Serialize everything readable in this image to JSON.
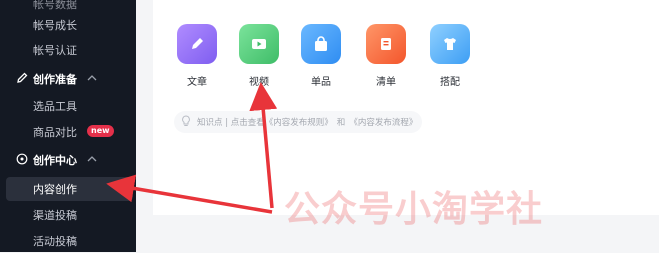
{
  "sidebar": {
    "top_cut_label": "帐号数据",
    "items_top": [
      {
        "label": "帐号成长"
      },
      {
        "label": "帐号认证"
      }
    ],
    "group_prep": {
      "label": "创作准备",
      "icon": "pencil-icon"
    },
    "prep_items": [
      {
        "label": "选品工具"
      },
      {
        "label": "商品对比",
        "badge": "new"
      }
    ],
    "group_center": {
      "label": "创作中心",
      "icon": "compass-icon"
    },
    "center_items": [
      {
        "label": "内容创作",
        "active": true
      },
      {
        "label": "渠道投稿"
      },
      {
        "label": "活动投稿"
      }
    ]
  },
  "tools": [
    {
      "label": "文章",
      "icon": "pen-icon",
      "color": "#8f6bf5"
    },
    {
      "label": "视频",
      "icon": "video-icon",
      "color": "#4cc677"
    },
    {
      "label": "单品",
      "icon": "shopping-bag-icon",
      "color": "#3f9cf4"
    },
    {
      "label": "清单",
      "icon": "list-icon",
      "color": "#f7683d"
    },
    {
      "label": "搭配",
      "icon": "shirt-icon",
      "color": "#49a8f5"
    }
  ],
  "tip": {
    "icon": "lightbulb-icon",
    "prefix": "知识点 | 点击查看",
    "link1": "《内容发布规则》",
    "conj": "和",
    "link2": "《内容发布流程》"
  },
  "watermark": "公众号小淘学社",
  "annotation_color": "#e8343a"
}
